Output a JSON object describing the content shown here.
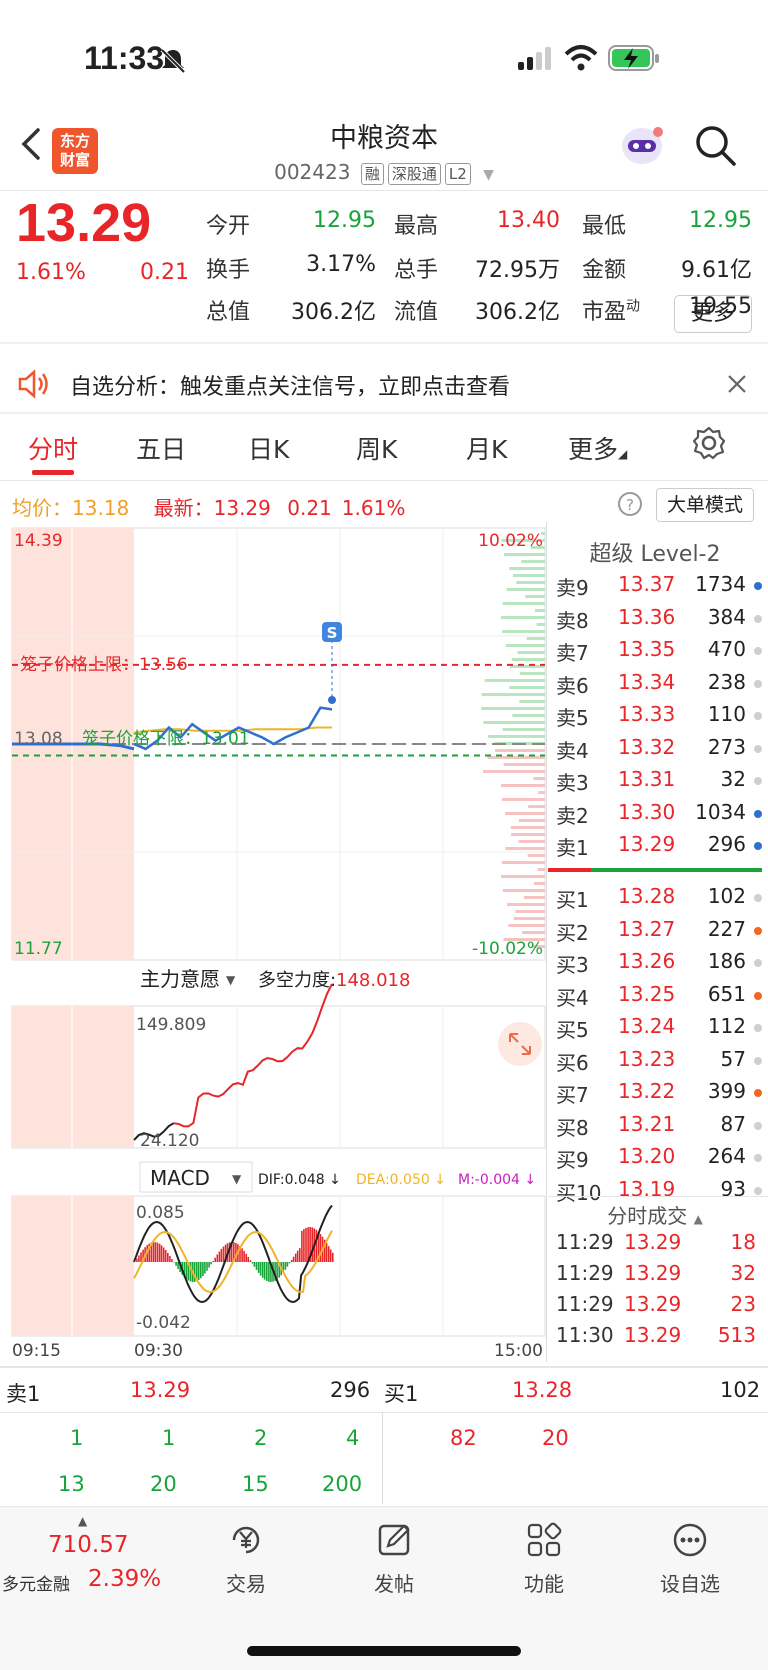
{
  "status": {
    "time": "11:33"
  },
  "header": {
    "logo_line1": "东方",
    "logo_line2": "财富",
    "stock_name": "中粮资本",
    "stock_code": "002423",
    "tags": [
      "融",
      "深股通",
      "L2"
    ]
  },
  "quote": {
    "price": "13.29",
    "change_pct": "1.61%",
    "change": "0.21",
    "fields": [
      {
        "label": "今开",
        "value": "12.95",
        "color": "green"
      },
      {
        "label": "最高",
        "value": "13.40",
        "color": "red"
      },
      {
        "label": "最低",
        "value": "12.95",
        "color": "green"
      },
      {
        "label": "换手",
        "value": "3.17%",
        "color": "black"
      },
      {
        "label": "总手",
        "value": "72.95万",
        "color": "black"
      },
      {
        "label": "金额",
        "value": "9.61亿",
        "color": "black"
      },
      {
        "label": "总值",
        "value": "306.2亿",
        "color": "black"
      },
      {
        "label": "流值",
        "value": "306.2亿",
        "color": "black"
      },
      {
        "label": "市盈",
        "label_sup": "动",
        "value": "19.55",
        "color": "black"
      }
    ],
    "more_label": "更多"
  },
  "notice": {
    "text": "自选分析：触发重点关注信号，立即点击查看"
  },
  "tabs": [
    "分时",
    "五日",
    "日K",
    "周K",
    "月K",
    "更多"
  ],
  "chart_info": {
    "avg_label": "均价：",
    "avg_value": "13.18",
    "latest_label": "最新：",
    "latest_value": "13.29",
    "latest_change": "0.21",
    "latest_pct": "1.61%",
    "big_order_btn": "大单模式"
  },
  "chart_labels": {
    "top_price": "14.39",
    "bottom_price": "11.77",
    "top_pct": "10.02%",
    "bottom_pct": "-10.02%",
    "mid_price": "13.08",
    "cage_upper": "笼子价格上限：13.56",
    "cage_lower": "笼子价格下限：13.01",
    "signal_marker": "S",
    "ind1_name": "主力意愿",
    "ind1_extra_label": "多空力度:",
    "ind1_extra_value": "148.018",
    "ind1_max": "149.809",
    "ind1_min": "24.120",
    "macd_name": "MACD",
    "dif": "DIF:0.048 ↓",
    "dea": "DEA:0.050 ↓",
    "m": "M:-0.004 ↓",
    "macd_max": "0.085",
    "macd_min": "-0.042",
    "time_start": "09:15",
    "time_open": "09:30",
    "time_end": "15:00"
  },
  "chart_data": {
    "type": "line",
    "title": "",
    "x": [
      "09:15",
      "09:30",
      "11:30"
    ],
    "ylim": [
      11.77,
      14.39
    ],
    "series": [
      {
        "name": "最新",
        "values": [
          13.08,
          13.05,
          13.1,
          13.18,
          13.12,
          13.2,
          13.15,
          13.1,
          13.14,
          13.18,
          13.15,
          13.12,
          13.08,
          13.12,
          13.15,
          13.18,
          13.3,
          13.29
        ]
      },
      {
        "name": "均价",
        "values": [
          13.15,
          13.16,
          13.17,
          13.17,
          13.16,
          13.16,
          13.16,
          13.16,
          13.17,
          13.17,
          13.17,
          13.17,
          13.18,
          13.18
        ]
      }
    ],
    "reference_lines": {
      "prev_close": 13.08,
      "cage_upper": 13.56,
      "cage_lower": 13.01
    }
  },
  "level2": {
    "title": "超级 Level-2",
    "asks": [
      {
        "label": "卖9",
        "price": "13.37",
        "vol": "1734",
        "dot": "#2f6fd0"
      },
      {
        "label": "卖8",
        "price": "13.36",
        "vol": "384",
        "dot": "#cfcfcf"
      },
      {
        "label": "卖7",
        "price": "13.35",
        "vol": "470",
        "dot": "#cfcfcf"
      },
      {
        "label": "卖6",
        "price": "13.34",
        "vol": "238",
        "dot": "#cfcfcf"
      },
      {
        "label": "卖5",
        "price": "13.33",
        "vol": "110",
        "dot": "#cfcfcf"
      },
      {
        "label": "卖4",
        "price": "13.32",
        "vol": "273",
        "dot": "#cfcfcf"
      },
      {
        "label": "卖3",
        "price": "13.31",
        "vol": "32",
        "dot": "#cfcfcf"
      },
      {
        "label": "卖2",
        "price": "13.30",
        "vol": "1034",
        "dot": "#2f6fd0"
      },
      {
        "label": "卖1",
        "price": "13.29",
        "vol": "296",
        "dot": "#2f6fd0"
      }
    ],
    "bids": [
      {
        "label": "买1",
        "price": "13.28",
        "vol": "102",
        "dot": "#cfcfcf"
      },
      {
        "label": "买2",
        "price": "13.27",
        "vol": "227",
        "dot": "#f06a1e"
      },
      {
        "label": "买3",
        "price": "13.26",
        "vol": "186",
        "dot": "#cfcfcf"
      },
      {
        "label": "买4",
        "price": "13.25",
        "vol": "651",
        "dot": "#f06a1e"
      },
      {
        "label": "买5",
        "price": "13.24",
        "vol": "112",
        "dot": "#cfcfcf"
      },
      {
        "label": "买6",
        "price": "13.23",
        "vol": "57",
        "dot": "#cfcfcf"
      },
      {
        "label": "买7",
        "price": "13.22",
        "vol": "399",
        "dot": "#f06a1e"
      },
      {
        "label": "买8",
        "price": "13.21",
        "vol": "87",
        "dot": "#cfcfcf"
      },
      {
        "label": "买9",
        "price": "13.20",
        "vol": "264",
        "dot": "#cfcfcf"
      },
      {
        "label": "买10",
        "price": "13.19",
        "vol": "93",
        "dot": "#cfcfcf"
      }
    ]
  },
  "ticks": {
    "title": "分时成交",
    "rows": [
      {
        "time": "11:29",
        "price": "13.29",
        "vol": "18"
      },
      {
        "time": "11:29",
        "price": "13.29",
        "vol": "32"
      },
      {
        "time": "11:29",
        "price": "13.29",
        "vol": "23"
      },
      {
        "time": "11:30",
        "price": "13.29",
        "vol": "513"
      }
    ]
  },
  "bottom_quote": {
    "sell_label": "卖1",
    "sell_price": "13.29",
    "sell_vol": "296",
    "buy_label": "买1",
    "buy_price": "13.28",
    "buy_vol": "102",
    "sell_queue_row1": [
      "1",
      "1",
      "2",
      "4"
    ],
    "sell_queue_row2": [
      "13",
      "20",
      "15",
      "200"
    ],
    "buy_queue_row1": [
      "82",
      "20"
    ]
  },
  "bottom_nav": {
    "index_value": "710.57",
    "index_name": "多元金融",
    "index_pct": "2.39%",
    "items": [
      "交易",
      "发帖",
      "功能",
      "设自选"
    ]
  },
  "colors": {
    "up": "#e8262a",
    "down": "#1aa33a",
    "accent": "#f0562d",
    "avg_line": "#f0b429",
    "price_line": "#2f6fd0"
  }
}
